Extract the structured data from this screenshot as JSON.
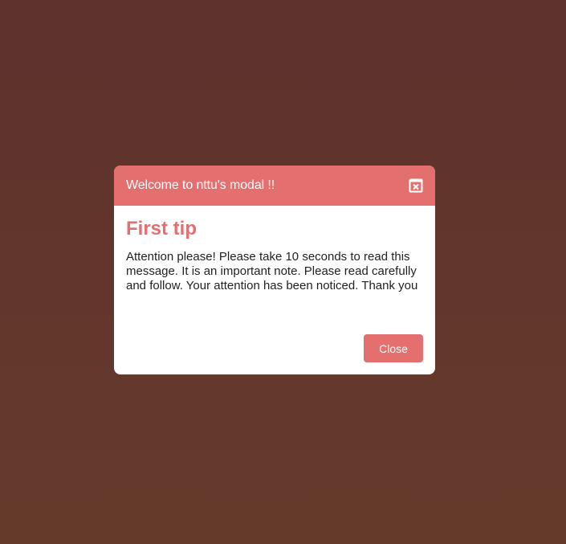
{
  "modal": {
    "title": "Welcome to nttu's modal !!",
    "heading": "First tip",
    "message": "Attention please! Please take 10 seconds to read this message. It is an important note. Please read carefully and follow. Your attention has been noticed. Thank you",
    "close_label": "Close",
    "header_close_icon": "close-window-icon"
  },
  "colors": {
    "background_top": "#5e322d",
    "background_bottom": "#663a2b",
    "accent": "#e46f6f",
    "modal_body": "#ffffff",
    "text": "#222222"
  }
}
